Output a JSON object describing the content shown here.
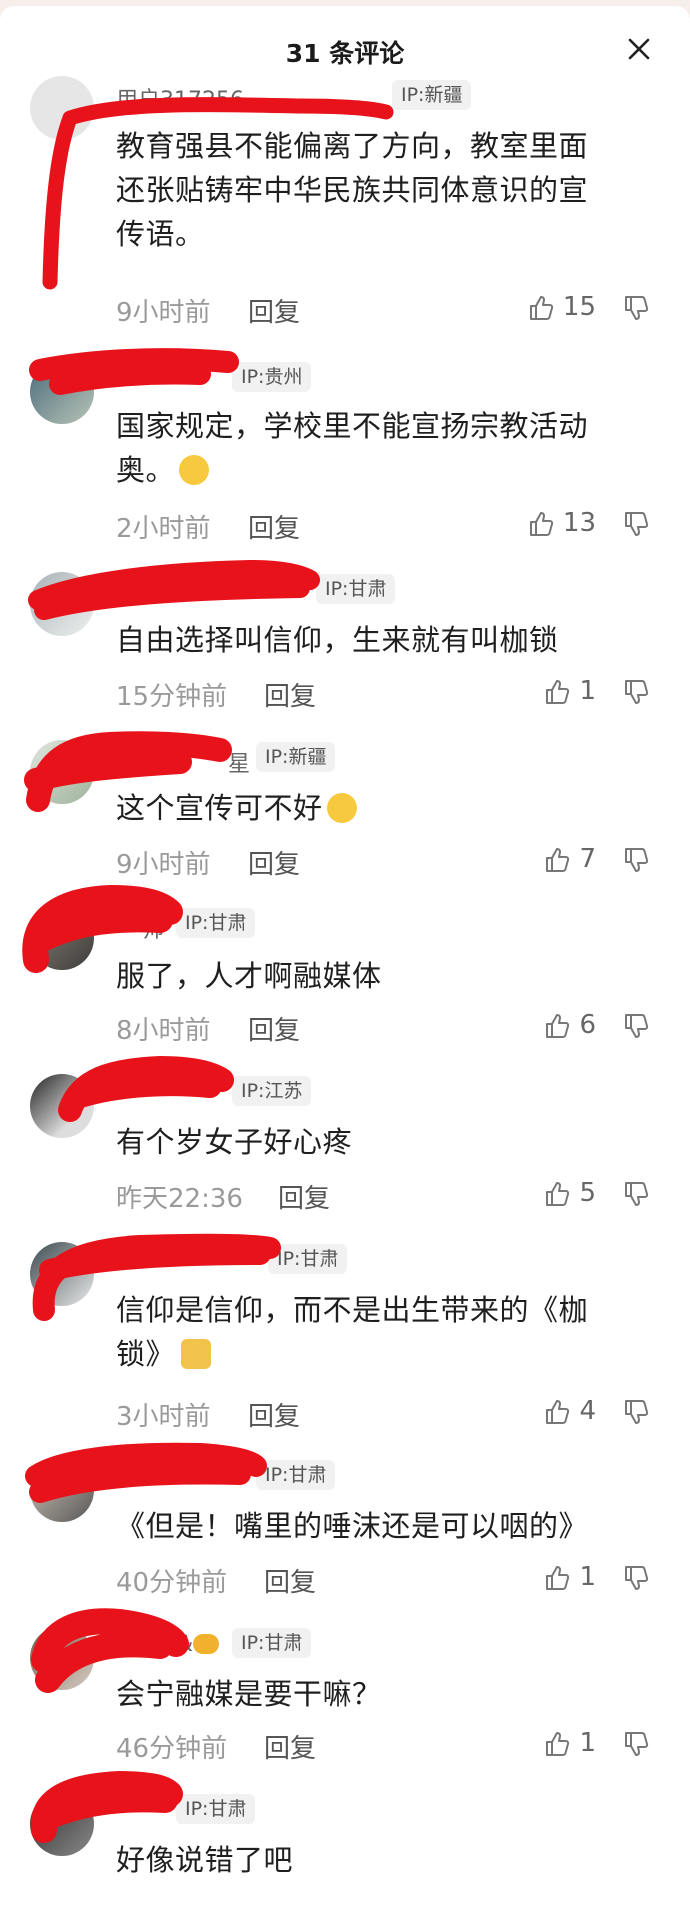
{
  "header": {
    "title": "31 条评论",
    "close_icon": "close-icon"
  },
  "comments": [
    {
      "username": "用户317256...",
      "ip": "IP:新疆",
      "text_lines": [
        "教育强县不能偏离了方向，教室里面",
        "还张贴铸牢中华民族共同体意识的宣",
        "传语。"
      ],
      "time": "9小时前",
      "reply": "回复",
      "likes": "15"
    },
    {
      "username": "",
      "ip": "IP:贵州",
      "text_lines": [
        "国家规定，学校里不能宣扬宗教活动",
        "奥。"
      ],
      "emoji": "laughing-crying-emoji",
      "time": "2小时前",
      "reply": "回复",
      "likes": "13"
    },
    {
      "username": "",
      "ip": "IP:甘肃",
      "text_lines": [
        "自由选择叫信仰，生来就有叫枷锁"
      ],
      "time": "15分钟前",
      "reply": "回复",
      "likes": "1"
    },
    {
      "username": "星",
      "ip": "IP:新疆",
      "text_lines": [
        "这个宣传可不好"
      ],
      "emoji": "rolling-laugh-emoji",
      "time": "9小时前",
      "reply": "回复",
      "likes": "7"
    },
    {
      "username": "帅",
      "ip": "IP:甘肃",
      "text_lines": [
        "服了，人才啊融媒体"
      ],
      "time": "8小时前",
      "reply": "回复",
      "likes": "6"
    },
    {
      "username": "",
      "ip": "IP:江苏",
      "text_lines": [
        "有个岁女子好心疼"
      ],
      "time": "昨天22:36",
      "reply": "回复",
      "likes": "5"
    },
    {
      "username": "",
      "ip": "IP:甘肃",
      "text_lines": [
        "信仰是信仰，而不是出生带来的《枷",
        "锁》"
      ],
      "emoji": "cat-emoji",
      "time": "3小时前",
      "reply": "回复",
      "likes": "4"
    },
    {
      "username": "",
      "ip": "IP:甘肃",
      "text_lines": [
        "《但是！嘴里的唾沫还是可以咽的》"
      ],
      "time": "40分钟前",
      "reply": "回复",
      "likes": "1"
    },
    {
      "username": "&",
      "ip": "IP:甘肃",
      "text_lines": [
        "会宁融媒是要干嘛？"
      ],
      "time": "46分钟前",
      "reply": "回复",
      "likes": "1"
    },
    {
      "username": "",
      "ip": "IP:甘肃",
      "text_lines": [
        "好像说错了吧"
      ]
    }
  ],
  "colors": {
    "redaction": "#e8121a",
    "meta_gray": "#9a9a9a",
    "ip_badge_bg": "#f1f1f1"
  },
  "icons": {
    "like": "thumbs-up-icon",
    "dislike": "thumbs-down-icon"
  }
}
